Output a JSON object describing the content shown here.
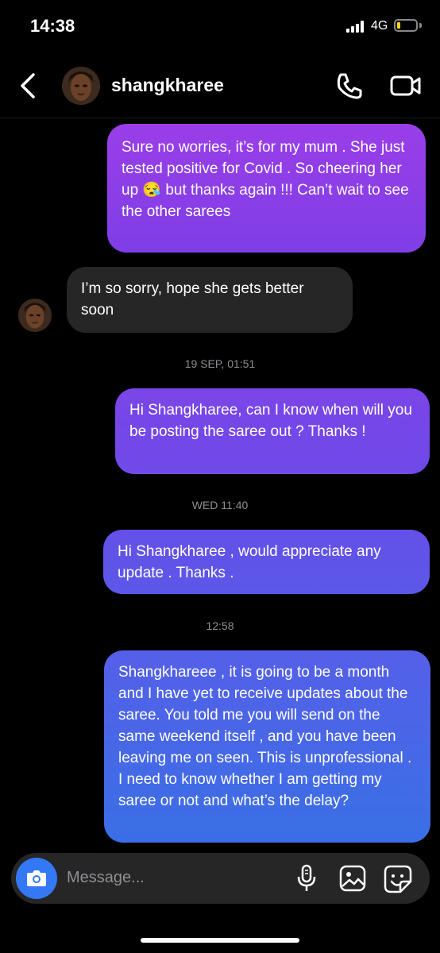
{
  "status_bar": {
    "time": "14:38",
    "network": "4G",
    "battery_level": 0.15,
    "battery_color": "#ffd60a"
  },
  "header": {
    "username": "shangkharee",
    "icons": [
      "back-chevron-icon",
      "phone-icon",
      "video-camera-icon"
    ]
  },
  "messages": [
    {
      "direction": "sent",
      "text": "Sure no worries, it’s for my mum . She just tested positive for Covid . So cheering her up 😪 but thanks again !!! Can’t wait to see the other sarees"
    },
    {
      "direction": "received",
      "text": "I’m so sorry, hope she gets better soon"
    },
    {
      "direction": "sent",
      "timestamp": "19 SEP, 01:51",
      "text": "Hi Shangkharee, can I know when will you be posting the saree out ? Thanks !"
    },
    {
      "direction": "sent",
      "timestamp": "WED 11:40",
      "text": "Hi Shangkharee , would appreciate any update . Thanks ."
    },
    {
      "direction": "sent",
      "timestamp": "12:58",
      "text": "Shangkhareee , it is going to be a month and I have yet to receive updates about the saree. You told me you will send on the same weekend itself , and you have been leaving me on seen. This is unprofessional . I need to know whether I am getting my saree or not and what’s the delay?"
    }
  ],
  "composer": {
    "placeholder": "Message...",
    "icons": [
      "camera-icon",
      "microphone-icon",
      "gallery-icon",
      "sticker-icon"
    ],
    "camera_button_color": "#3478f6"
  },
  "colors": {
    "background": "#000000",
    "received_bubble": "#262626",
    "sent_gradient_top": "#9a3ee8",
    "sent_gradient_bottom": "#3a6fe6",
    "timestamp": "#8e8e93"
  }
}
